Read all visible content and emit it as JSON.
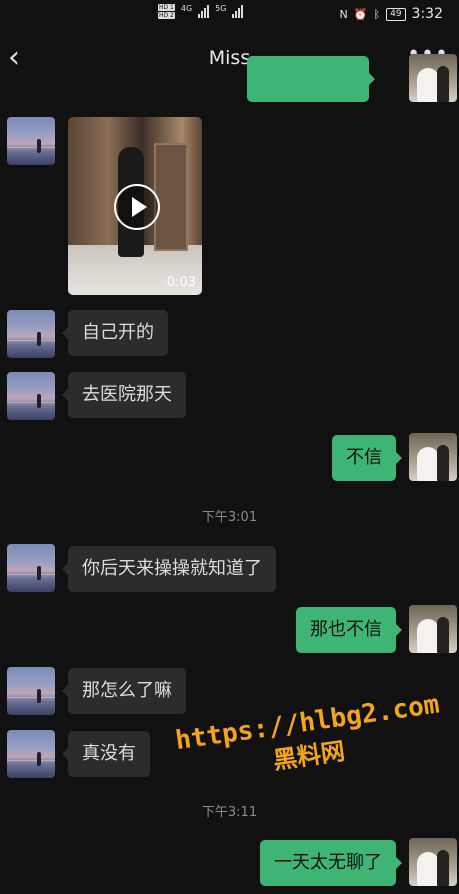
{
  "status_bar": {
    "hd1": "HD 1",
    "hd2": "HD 2",
    "net1": "4G",
    "net2": "5G",
    "nfc": "N",
    "alarm": "⏰",
    "bluetooth": "ᛒ",
    "battery": "49",
    "time": "3:32"
  },
  "header": {
    "back_icon": "‹",
    "title": "Miss",
    "more_icon": "•••"
  },
  "video_message": {
    "duration": "0:03"
  },
  "messages": [
    {
      "side": "in",
      "text": "自己开的"
    },
    {
      "side": "in",
      "text": "去医院那天"
    },
    {
      "side": "out",
      "text": "不信"
    },
    {
      "side": "in",
      "text": "你后天来操操就知道了"
    },
    {
      "side": "out",
      "text": "那也不信"
    },
    {
      "side": "in",
      "text": "那怎么了嘛"
    },
    {
      "side": "in",
      "text": "真没有"
    },
    {
      "side": "out",
      "text": "一天太无聊了"
    }
  ],
  "timestamps": [
    "下午3:01",
    "下午3:11"
  ],
  "watermark": {
    "url": "https://hlbg2.com",
    "name": "黑料网"
  },
  "colors": {
    "background": "#111111",
    "incoming_bubble": "#2c2c2c",
    "outgoing_bubble": "#3eb574",
    "watermark": "#f6a41c"
  }
}
